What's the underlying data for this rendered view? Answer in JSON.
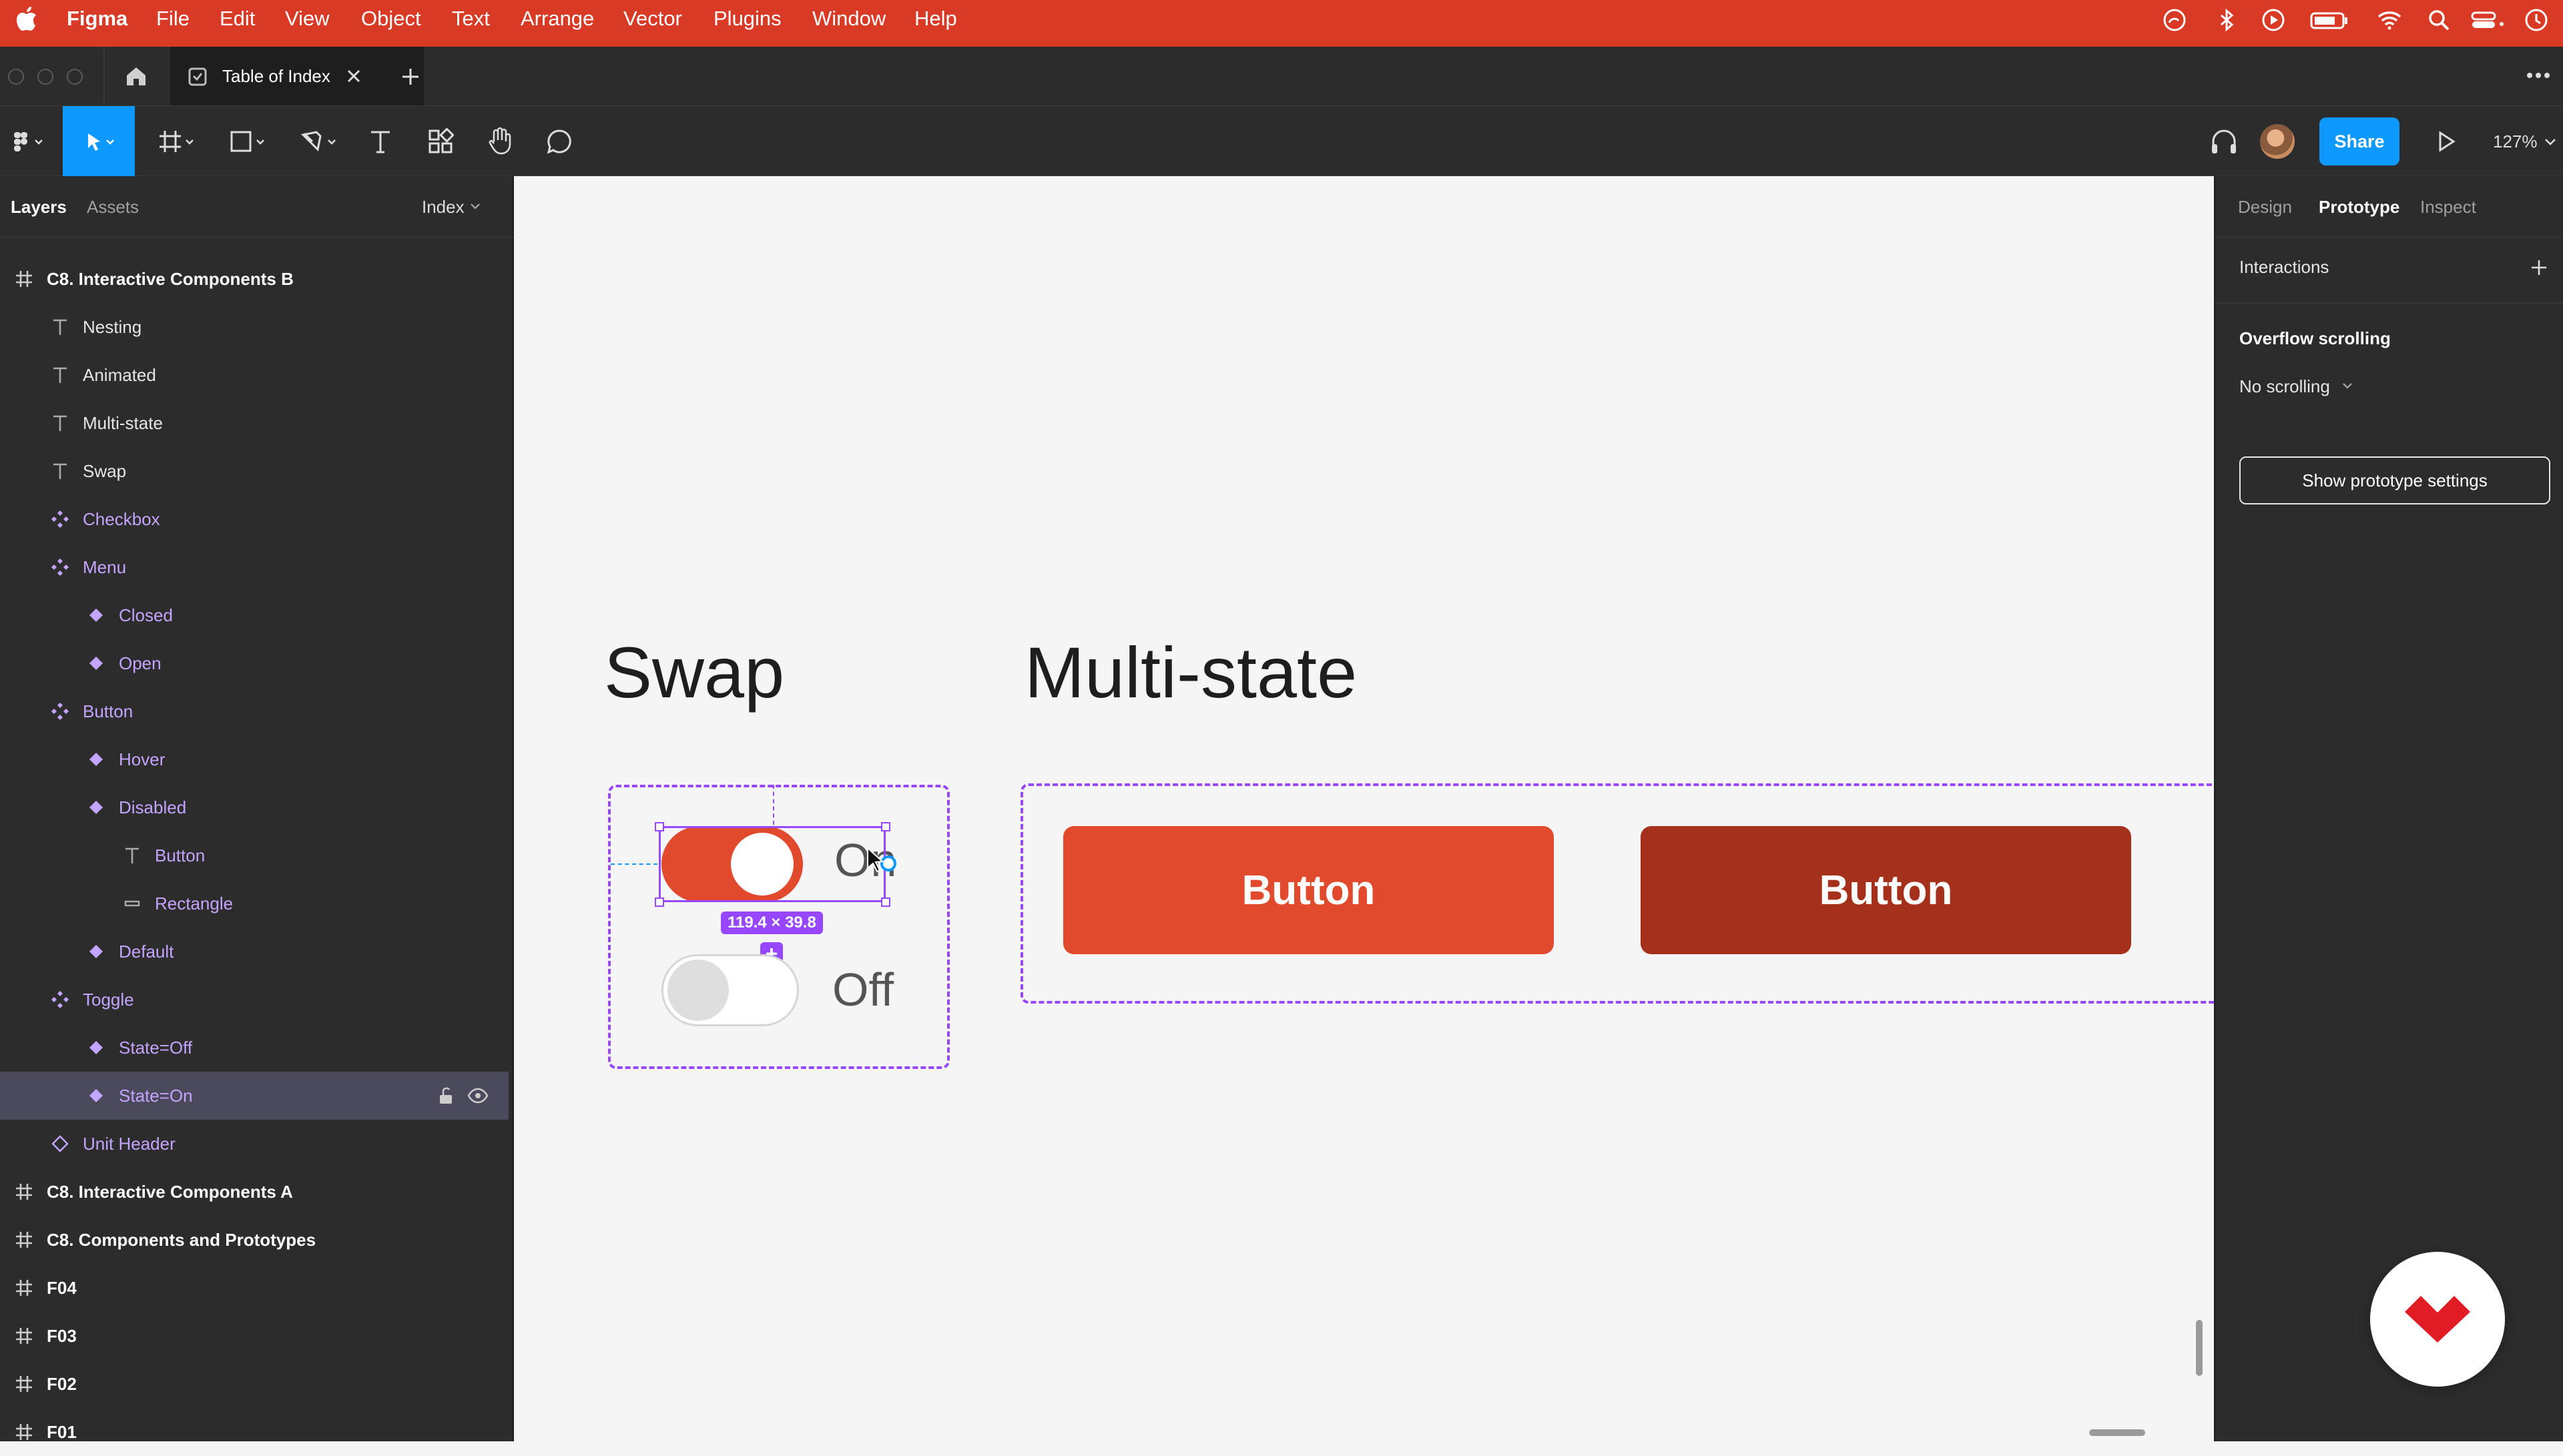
{
  "colors": {
    "menubar": "#d93a26",
    "accent_blue": "#0d99ff",
    "component_purple": "#c4a4ff",
    "toggle_on": "#e14a2c",
    "button_default": "#e14a2c",
    "button_pressed": "#a5301b",
    "selection": "#9747ff"
  },
  "menubar": {
    "app": "Figma",
    "items": [
      "File",
      "Edit",
      "View",
      "Object",
      "Text",
      "Arrange",
      "Vector",
      "Plugins",
      "Window",
      "Help"
    ]
  },
  "tabbar": {
    "tab_title": "Table of Index"
  },
  "toolbar": {
    "share_label": "Share",
    "zoom": "127%"
  },
  "left_panel": {
    "tabs": [
      "Layers",
      "Assets"
    ],
    "page_select": "Index",
    "layers": [
      {
        "label": "C8. Interactive Components B",
        "icon": "frame-icon"
      },
      {
        "label": "Nesting",
        "icon": "text-icon"
      },
      {
        "label": "Animated",
        "icon": "text-icon"
      },
      {
        "label": "Multi-state",
        "icon": "text-icon"
      },
      {
        "label": "Swap",
        "icon": "text-icon"
      },
      {
        "label": "Checkbox",
        "icon": "component-set-icon"
      },
      {
        "label": "Menu",
        "icon": "component-set-icon"
      },
      {
        "label": "Closed",
        "icon": "component-icon"
      },
      {
        "label": "Open",
        "icon": "component-icon"
      },
      {
        "label": "Button",
        "icon": "component-set-icon"
      },
      {
        "label": "Hover",
        "icon": "component-icon"
      },
      {
        "label": "Disabled",
        "icon": "component-icon"
      },
      {
        "label": "Button",
        "icon": "text-icon"
      },
      {
        "label": "Rectangle",
        "icon": "rectangle-icon"
      },
      {
        "label": "Default",
        "icon": "component-icon"
      },
      {
        "label": "Toggle",
        "icon": "component-set-icon"
      },
      {
        "label": "State=Off",
        "icon": "component-icon"
      },
      {
        "label": "State=On",
        "icon": "component-icon"
      },
      {
        "label": "Unit Header",
        "icon": "instance-icon"
      },
      {
        "label": "C8. Interactive Components A",
        "icon": "frame-icon"
      },
      {
        "label": "C8. Components and Prototypes",
        "icon": "frame-icon"
      },
      {
        "label": "F04",
        "icon": "frame-icon"
      },
      {
        "label": "F03",
        "icon": "frame-icon"
      },
      {
        "label": "F02",
        "icon": "frame-icon"
      },
      {
        "label": "F01",
        "icon": "frame-icon"
      }
    ]
  },
  "canvas": {
    "swap_title": "Swap",
    "multistate_title": "Multi-state",
    "toggle_on_label": "On",
    "toggle_off_label": "Off",
    "selection_size": "119.4 × 39.8",
    "button_default_label": "Button",
    "button_pressed_label": "Button"
  },
  "right_panel": {
    "tabs": [
      "Design",
      "Prototype",
      "Inspect"
    ],
    "interactions_label": "Interactions",
    "overflow_label": "Overflow scrolling",
    "overflow_value": "No scrolling",
    "prototype_settings_button": "Show prototype settings"
  }
}
